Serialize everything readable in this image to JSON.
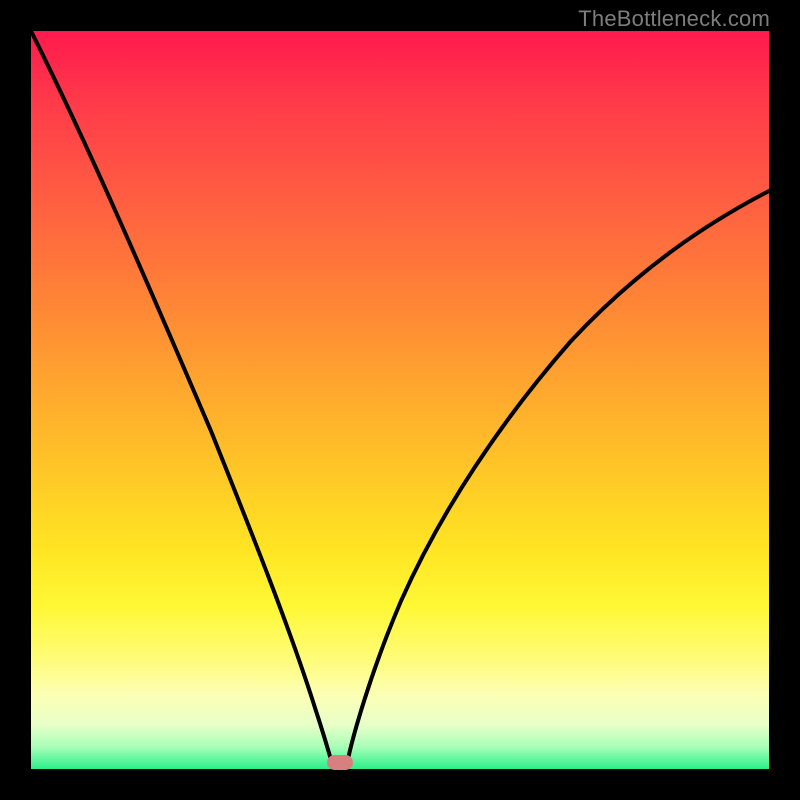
{
  "watermark": "TheBottleneck.com",
  "colors": {
    "frame": "#000000",
    "curve_stroke": "#000000",
    "marker": "#d88080",
    "watermark_text": "#7d7d7d"
  },
  "chart_data": {
    "type": "line",
    "title": "",
    "xlabel": "",
    "ylabel": "",
    "xlim": [
      0,
      100
    ],
    "ylim": [
      0,
      100
    ],
    "grid": false,
    "legend": false,
    "annotations": [
      {
        "text": "TheBottleneck.com",
        "position": "top-right"
      }
    ],
    "series": [
      {
        "name": "left-branch",
        "x": [
          0,
          5,
          10,
          15,
          20,
          25,
          30,
          33,
          36,
          38,
          39,
          40,
          40.5
        ],
        "values": [
          100,
          91,
          80,
          69,
          57,
          44,
          30,
          21,
          12,
          6,
          3,
          1,
          0
        ]
      },
      {
        "name": "right-branch",
        "x": [
          42,
          44,
          46,
          48,
          50,
          55,
          60,
          65,
          70,
          75,
          80,
          85,
          90,
          95,
          100
        ],
        "values": [
          0,
          5,
          10,
          14,
          18,
          27,
          35,
          42,
          49,
          55,
          60,
          65,
          70,
          74,
          78
        ]
      }
    ],
    "marker": {
      "x": 41,
      "y": 0
    }
  }
}
